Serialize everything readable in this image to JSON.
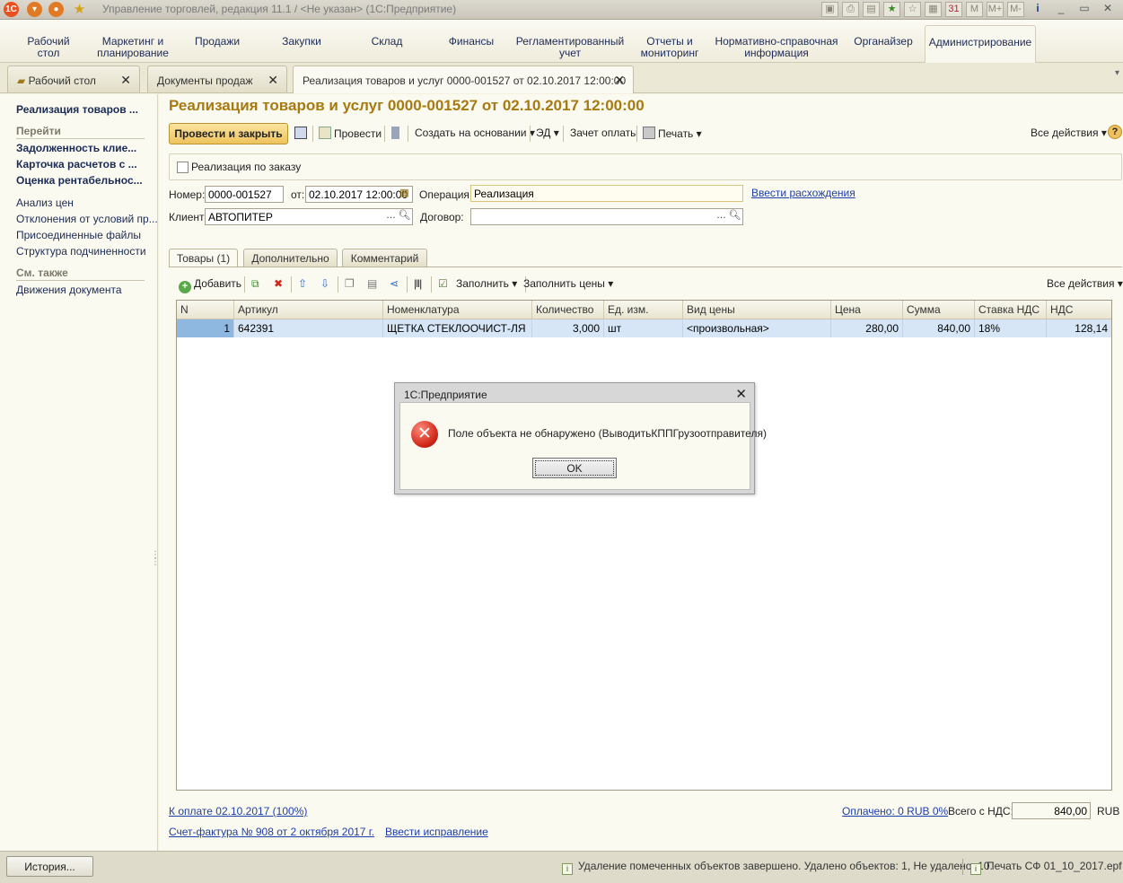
{
  "window": {
    "title": "Управление торговлей, редакция 11.1 / <Не указан>  (1С:Предприятие)"
  },
  "sections": [
    {
      "label": "Рабочий\nстол"
    },
    {
      "label": "Маркетинг и\nпланирование"
    },
    {
      "label": "Продажи"
    },
    {
      "label": "Закупки"
    },
    {
      "label": "Склад"
    },
    {
      "label": "Финансы"
    },
    {
      "label": "Регламентированный\nучет"
    },
    {
      "label": "Отчеты и\nмониторинг"
    },
    {
      "label": "Нормативно-справочная\nинформация"
    },
    {
      "label": "Органайзер"
    },
    {
      "label": "Администрирование"
    }
  ],
  "open_tabs": [
    {
      "label": "Рабочий стол"
    },
    {
      "label": "Документы продаж"
    },
    {
      "label": "Реализация товаров и услуг 0000-001527 от 02.10.2017 12:00:00"
    }
  ],
  "leftnav": {
    "doc_link": "Реализация товаров ...",
    "goto_header": "Перейти",
    "bold_items": [
      "Задолженность клие...",
      "Карточка расчетов с ...",
      "Оценка рентабельнос..."
    ],
    "items": [
      "Анализ цен",
      "Отклонения от условий пр...",
      "Присоединенные файлы",
      "Структура подчиненности"
    ],
    "see_also_header": "См. также",
    "see_also_items": [
      "Движения документа"
    ]
  },
  "form": {
    "title": "Реализация товаров и услуг 0000-001527 от 02.10.2017 12:00:00",
    "toolbar": {
      "post_close": "Провести и закрыть",
      "post": "Провести",
      "create_based": "Создать на основании",
      "ed": "ЭД",
      "offset": "Зачет оплаты",
      "print": "Печать",
      "all_actions": "Все действия"
    },
    "by_order_label": "Реализация по заказу",
    "number_label": "Номер:",
    "number_value": "0000-001527",
    "date_label": "от:",
    "date_value": "02.10.2017 12:00:00",
    "operation_label": "Операция:",
    "operation_value": "Реализация",
    "discrepancy_link": "Ввести расхождения",
    "client_label": "Клиент:",
    "client_value": "АВТОПИТЕР",
    "contract_label": "Договор:",
    "contract_value": "",
    "tabs": [
      "Товары (1)",
      "Дополнительно",
      "Комментарий"
    ],
    "table_toolbar": {
      "add": "Добавить",
      "fill": "Заполнить",
      "fill_prices": "Заполнить цены",
      "all_actions": "Все действия"
    },
    "table": {
      "columns": [
        "N",
        "Артикул",
        "Номенклатура",
        "Количество",
        "Ед. изм.",
        "Вид цены",
        "Цена",
        "Сумма",
        "Ставка НДС",
        "НДС"
      ],
      "rows": [
        [
          "1",
          "642391",
          "ЩЕТКА СТЕКЛООЧИСТ-ЛЯ",
          "3,000",
          "шт",
          "<произвольная>",
          "280,00",
          "840,00",
          "18%",
          "128,14"
        ]
      ]
    },
    "footer": {
      "payment_link": "К оплате 02.10.2017 (100%)",
      "paid_link": "Оплачено: 0 RUB  0%",
      "total_label": "Всего с НДС:",
      "total_value": "840,00",
      "currency": "RUB",
      "invoice_link": "Счет-фактура № 908 от 2 октября 2017 г.",
      "correction_link": "Ввести исправление"
    }
  },
  "statusbar": {
    "history_button": "История...",
    "message1": "Удаление помеченных объектов завершено. Удалено объектов: 1, Не удалено: 10.",
    "message2": "Печать СФ 01_10_2017.epf"
  },
  "dialog": {
    "title": "1С:Предприятие",
    "message": "Поле объекта не обнаружено (ВыводитьКППГрузоотправителя)",
    "ok": "OK"
  },
  "colors": {
    "title_accent": "#a8790f",
    "link": "#1d3fa8",
    "primary_button": "#eec35c",
    "selected_row": "#d6e6f6",
    "error_icon": "#d0271a"
  }
}
